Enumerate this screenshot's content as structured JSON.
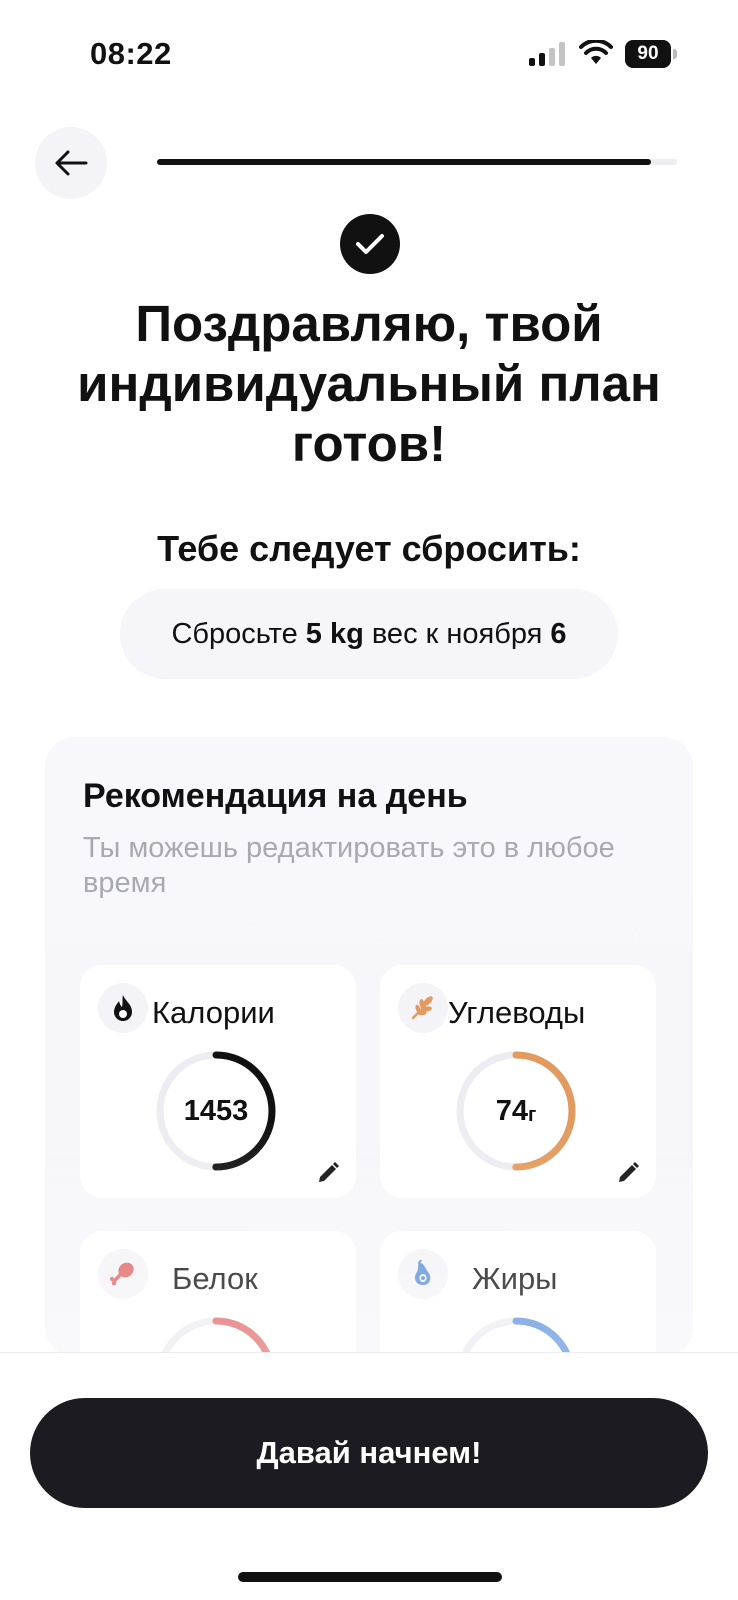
{
  "status_bar": {
    "time": "08:22",
    "battery": "90"
  },
  "header": {
    "progress": 0.95
  },
  "headline": "Поздравляю, твой индивидуальный план готов!",
  "subheadline": "Тебе следует сбросить:",
  "goal": {
    "prefix": "Сбросьте ",
    "amount": "5",
    "unit": " kg",
    "middle": " вес к ноября ",
    "day": "6"
  },
  "recommendation": {
    "title": "Рекомендация на день",
    "subtitle": "Ты можешь редактировать это в любое время",
    "cards": [
      {
        "label": "Калории",
        "value": "1453",
        "unit": "",
        "icon": "flame-icon",
        "color": "#111111",
        "progress": 0.5
      },
      {
        "label": "Углеводы",
        "value": "74",
        "unit": "г",
        "icon": "wheat-icon",
        "color": "#e29a5e",
        "progress": 0.5
      },
      {
        "label": "Белок",
        "value": "",
        "unit": "",
        "icon": "drumstick-icon",
        "color": "#e06666",
        "progress": 0.5
      },
      {
        "label": "Жиры",
        "value": "",
        "unit": "",
        "icon": "avocado-icon",
        "color": "#5b8fd9",
        "progress": 0.5
      }
    ]
  },
  "cta": {
    "label": "Давай начнем!"
  }
}
